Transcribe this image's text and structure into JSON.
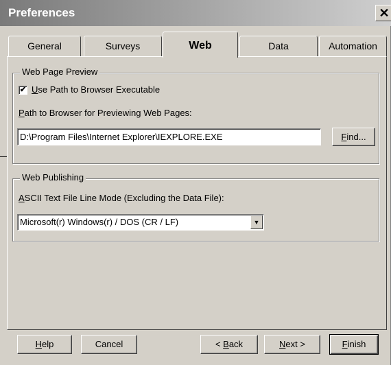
{
  "window": {
    "title": "Preferences",
    "close_glyph": "✕"
  },
  "tabs": [
    {
      "label": "General"
    },
    {
      "label": "Surveys"
    },
    {
      "label": "Web"
    },
    {
      "label": "Data"
    },
    {
      "label": "Automation"
    }
  ],
  "active_tab": "Web",
  "web_page_preview": {
    "legend": "Web Page Preview",
    "checkbox_label_mnemonic": "U",
    "checkbox_label_rest": "se Path to Browser Executable",
    "checkbox_checked": true,
    "checkbox_mark": "✔",
    "path_label_mnemonic": "P",
    "path_label_rest": "ath to Browser for Previewing Web Pages:",
    "path_value": "D:\\Program Files\\Internet Explorer\\IEXPLORE.EXE",
    "find_button_mnemonic": "F",
    "find_button_rest": "ind..."
  },
  "web_publishing": {
    "legend": "Web Publishing",
    "mode_label_mnemonic": "A",
    "mode_label_rest": "SCII Text File Line Mode (Excluding the Data File):",
    "mode_selected": "Microsoft(r) Windows(r) / DOS (CR / LF)",
    "dropdown_glyph": "▼"
  },
  "footer": {
    "help_mnemonic": "H",
    "help_rest": "elp",
    "cancel": "Cancel",
    "back_prefix": "< ",
    "back_mnemonic": "B",
    "back_rest": "ack",
    "next_mnemonic": "N",
    "next_rest": "ext >",
    "finish_mnemonic": "F",
    "finish_rest": "inish"
  }
}
